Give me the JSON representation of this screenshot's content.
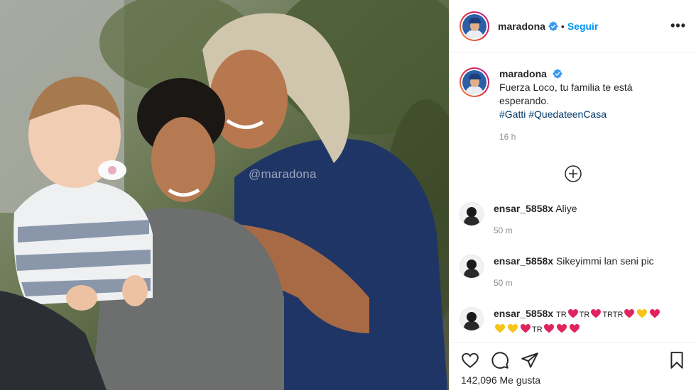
{
  "photo": {
    "watermark": "@maradona"
  },
  "header": {
    "username": "maradona",
    "separator": "•",
    "follow_label": "Seguir",
    "more_label": "•••"
  },
  "caption": {
    "username": "maradona",
    "line1": "Fuerza Loco, tu familia te está",
    "line2": "esperando.",
    "hashtags": [
      "#Gatti",
      "#QuedateenCasa"
    ],
    "time": "16 h"
  },
  "comments": [
    {
      "username": "ensar_5858x",
      "text": "Aliye",
      "time": "50 m"
    },
    {
      "username": "ensar_5858x",
      "text": "Sikeyimmi lan seni pic",
      "time": "50 m"
    },
    {
      "username": "ensar_5858x",
      "line1": [
        "TR",
        "red",
        "TR",
        "red",
        "TRTR",
        "red",
        "yellow",
        "red"
      ],
      "line2": [
        "yellow",
        "yellow",
        "red",
        "TR",
        "red",
        "red",
        "red"
      ]
    }
  ],
  "actions": {
    "likes": "142,096 Me gusta"
  },
  "colors": {
    "accent": "#0095f6",
    "hashtag": "#00376b",
    "heart_red": "#e0245e",
    "heart_yellow": "#f5c518"
  }
}
